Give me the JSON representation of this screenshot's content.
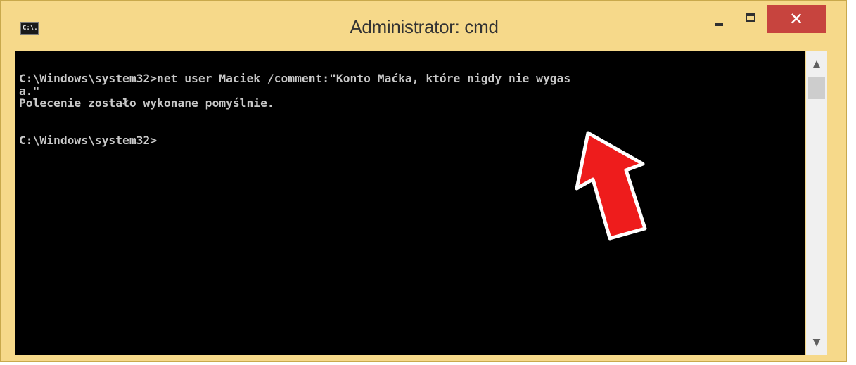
{
  "window": {
    "title": "Administrator: cmd",
    "icon": "cmd-console-icon",
    "icon_text": "C:\\."
  },
  "controls": {
    "minimize": "minimize-icon",
    "maximize": "maximize-icon",
    "close_label": "✕"
  },
  "console": {
    "lines": [
      "C:\\Windows\\system32>net user Maciek /comment:\"Konto Maćka, które nigdy nie wygas",
      "a.\"",
      "Polecenie zostało wykonane pomyślnie.",
      "",
      "",
      "C:\\Windows\\system32>"
    ]
  },
  "overlay": {
    "arrow_color": "#ee1c1c",
    "arrow_outline": "#ffffff"
  },
  "scrollbar": {
    "up": "▲",
    "down": "▼"
  },
  "colors": {
    "frame": "#f6d98a",
    "close": "#c7443e",
    "console_bg": "#000000",
    "console_fg": "#c8c8c8"
  }
}
